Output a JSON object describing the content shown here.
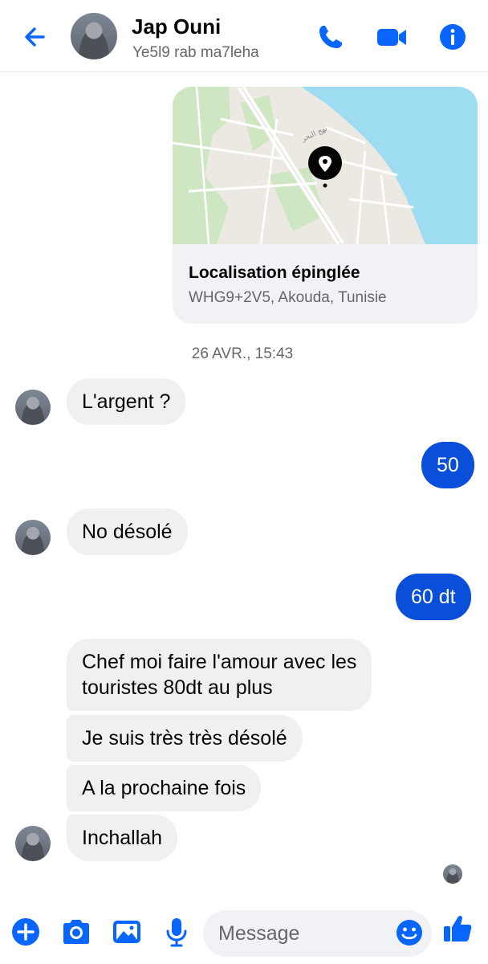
{
  "header": {
    "contact_name": "Jap Ouni",
    "status": "Ye5l9 rab ma7leha"
  },
  "location": {
    "title": "Localisation épinglée",
    "address": "WHG9+2V5, Akouda, Tunisie",
    "map_label": "نهج البحر"
  },
  "timestamp": "26 AVR., 15:43",
  "messages": [
    {
      "side": "in",
      "text": "L'argent ?"
    },
    {
      "side": "out",
      "text": "50"
    },
    {
      "side": "in",
      "text": "No désolé"
    },
    {
      "side": "out",
      "text": "60 dt"
    },
    {
      "side": "in",
      "text_line1": "Chef moi faire l'amour avec les",
      "text_line2": "touristes 80dt au plus"
    },
    {
      "side": "in",
      "text": "Je suis très très désolé"
    },
    {
      "side": "in",
      "text": "A la prochaine fois"
    },
    {
      "side": "in",
      "text": "Inchallah"
    }
  ],
  "composer": {
    "placeholder": "Message"
  },
  "colors": {
    "accent": "#0866ff",
    "outgoing_bubble": "#0a4fd9",
    "incoming_bubble": "#f0f0f0",
    "secondary_text": "#65676b"
  }
}
